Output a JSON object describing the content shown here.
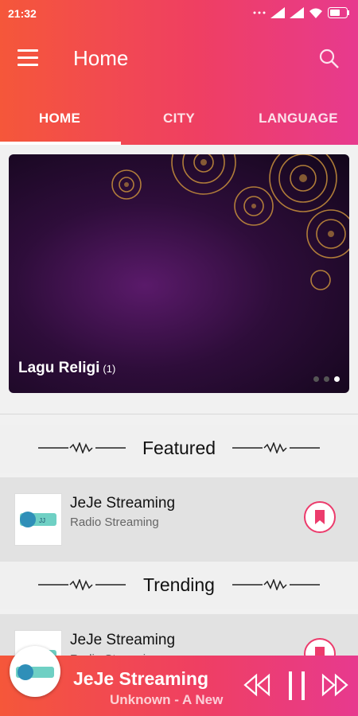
{
  "statusbar": {
    "time": "21:32"
  },
  "appbar": {
    "title": "Home"
  },
  "tabs": [
    {
      "label": "HOME"
    },
    {
      "label": "CITY"
    },
    {
      "label": "LANGUAGE"
    }
  ],
  "banner": {
    "caption": "Lagu Religi",
    "count": "(1)"
  },
  "sections": [
    {
      "title": "Featured",
      "item": {
        "name": "JeJe Streaming",
        "subtitle": "Radio Streaming"
      }
    },
    {
      "title": "Trending",
      "item": {
        "name": "JeJe Streaming",
        "subtitle": "Radio Streaming"
      }
    }
  ],
  "player": {
    "station": "JeJe Streaming",
    "track": "Unknown - A New"
  },
  "colors": {
    "accent_start": "#f5573a",
    "accent_end": "#e73a8e",
    "fav": "#ec3b6c"
  }
}
